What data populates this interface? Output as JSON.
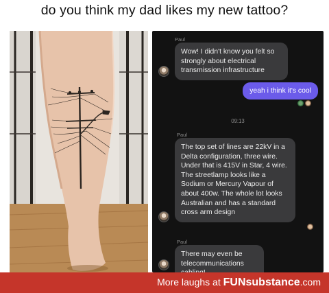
{
  "title": "do you think my dad likes my new tattoo?",
  "chat": {
    "messages": [
      {
        "sender": "Paul",
        "text": "Wow! I didn't know you felt so strongly about electrical transmission infrastructure"
      },
      {
        "reply": "yeah i think it's cool"
      },
      {
        "timestamp": "09:13"
      },
      {
        "sender": "Paul",
        "text": "The top set of lines are 22kV in a Delta configuration, three wire. Under that is 415V in Star, 4 wire. The streetlamp looks like a Sodium or Mercury Vapour of about 400w. The whole lot looks Australian and has a standard cross arm design"
      },
      {
        "sender": "Paul",
        "text": "There may even be telecommunications cabling!"
      }
    ]
  },
  "footer": {
    "prefix": "More laughs at ",
    "brand": "FUNsubstance",
    "suffix": ".com"
  },
  "colors": {
    "outgoing_bubble": "#6b5bea",
    "incoming_bubble": "#3a3a3c",
    "chat_background": "#121212",
    "footer_background": "#c5352a"
  }
}
